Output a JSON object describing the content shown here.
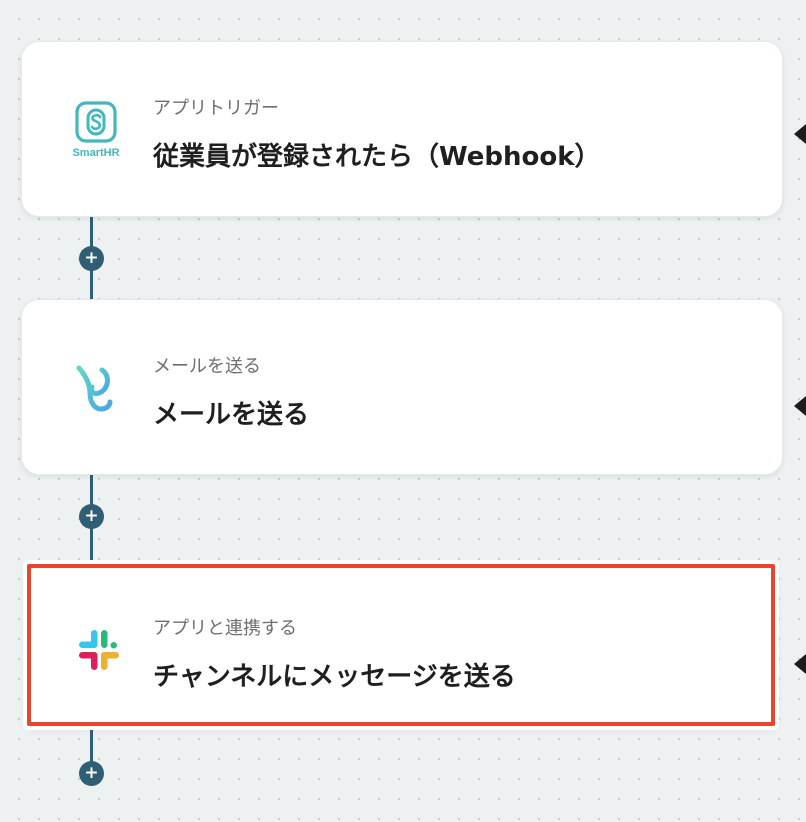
{
  "steps": [
    {
      "subtitle": "アプリトリガー",
      "title": "従業員が登録されたら（Webhook）",
      "icon": "smarthr-logo-icon",
      "icon_label": "SmartHR",
      "selected": false
    },
    {
      "subtitle": "メールを送る",
      "title": "メールを送る",
      "icon": "mail-logo-icon",
      "selected": false
    },
    {
      "subtitle": "アプリと連携する",
      "title": "チャンネルにメッセージを送る",
      "icon": "slack-logo-icon",
      "selected": true
    }
  ],
  "add_button_glyph": "+",
  "colors": {
    "connector": "#2f5e75",
    "selected_border": "#e8452a",
    "smarthr_teal": "#3fb8be",
    "slack_blue": "#36c5f0",
    "slack_green": "#2eb67d",
    "slack_yellow": "#ecb22e",
    "slack_red": "#e01e5a"
  }
}
